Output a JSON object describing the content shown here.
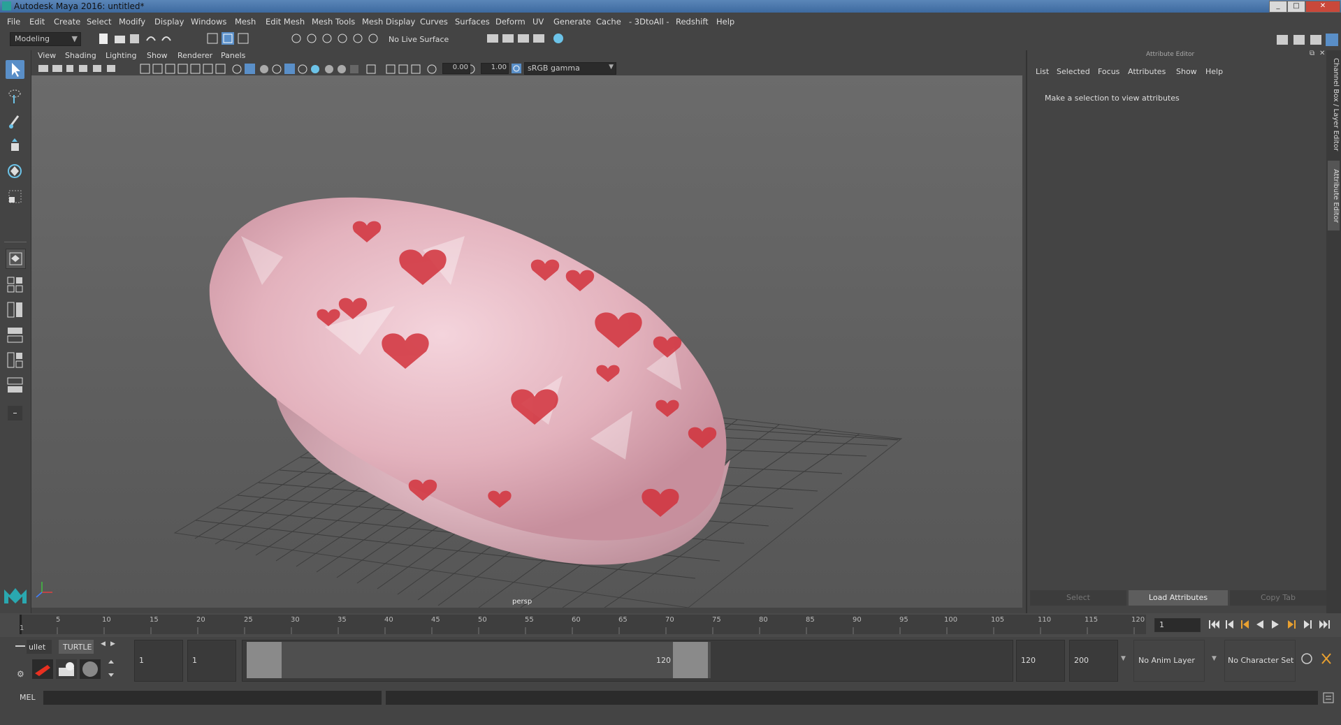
{
  "window": {
    "title": "Autodesk Maya 2016: untitled*"
  },
  "menubar": [
    "File",
    "Edit",
    "Create",
    "Select",
    "Modify",
    "Display",
    "Windows",
    "Mesh",
    "Edit Mesh",
    "Mesh Tools",
    "Mesh Display",
    "Curves",
    "Surfaces",
    "Deform",
    "UV",
    "Generate",
    "Cache",
    "- 3DtoAll -",
    "Redshift",
    "Help"
  ],
  "status_line": {
    "workspace_menu": "Modeling",
    "live_surface": "No Live Surface"
  },
  "viewport": {
    "menu": [
      "View",
      "Shading",
      "Lighting",
      "Show",
      "Renderer",
      "Panels"
    ],
    "exposure": "0.00",
    "gamma": "1.00",
    "color_space": "sRGB gamma",
    "camera_label": "persp"
  },
  "attribute_editor": {
    "title": "Attribute Editor",
    "menu": [
      "List",
      "Selected",
      "Focus",
      "Attributes",
      "Show",
      "Help"
    ],
    "message": "Make a selection to view attributes",
    "buttons": {
      "select": "Select",
      "load": "Load Attributes",
      "copy": "Copy Tab"
    }
  },
  "side_tabs": {
    "channel_box": "Channel Box / Layer Editor",
    "attribute_editor": "Attribute Editor"
  },
  "time_slider": {
    "ticks": [
      "1",
      "5",
      "10",
      "15",
      "20",
      "25",
      "30",
      "35",
      "40",
      "45",
      "50",
      "55",
      "60",
      "65",
      "70",
      "75",
      "80",
      "85",
      "90",
      "95",
      "100",
      "105",
      "110",
      "115",
      "120"
    ],
    "current_frame": "1"
  },
  "range_slider": {
    "shelf_tabs": [
      "ullet",
      "TURTLE"
    ],
    "start_time": "1",
    "playback_start": "1",
    "range_start_label": "1",
    "range_end_label": "120",
    "playback_end": "120",
    "end_time": "200",
    "anim_layer": "No Anim Layer",
    "character_set": "No Character Set"
  },
  "command_line": {
    "label": "MEL"
  },
  "colors": {
    "accent": "#5a8fc8",
    "viewport_bg": "#5f5f5f",
    "panel_bg": "#444444",
    "object_pink": "#e8b4bf",
    "heart_red": "#d2323c"
  }
}
